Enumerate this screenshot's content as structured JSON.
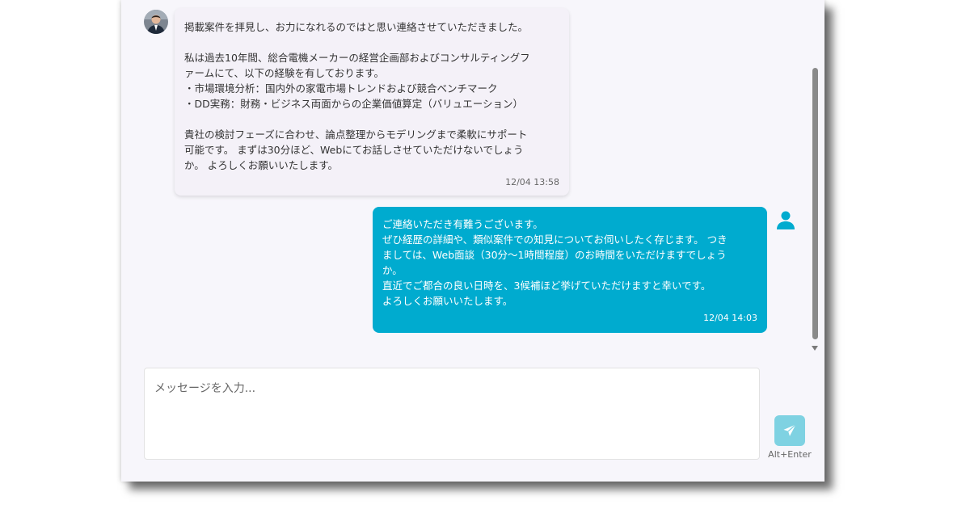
{
  "messages": [
    {
      "side": "received",
      "lines": [
        "掲載案件を拝見し、お力になれるのではと思い連絡させていただきました。",
        "",
        "私は過去10年間、総合電機メーカーの経営企画部およびコンサルティングフ",
        "ァームにて、以下の経験を有しております。",
        "・市場環境分析：国内外の家電市場トレンドおよび競合ベンチマーク",
        "・DD実務：財務・ビジネス両面からの企業価値算定（バリュエーション）",
        "",
        "貴社の検討フェーズに合わせ、論点整理からモデリングまで柔軟にサポート",
        "可能です。 まずは30分ほど、Webにてお話しさせていただけないでしょう",
        "か。 よろしくお願いいたします。"
      ],
      "time": "12/04 13:58"
    },
    {
      "side": "sent",
      "lines": [
        "ご連絡いただき有難うございます。",
        "ぜひ経歴の詳細や、類似案件での知見についてお伺いしたく存じます。 つき",
        "ましては、Web面談（30分〜1時間程度）のお時間をいただけますでしょう",
        "か。",
        "直近でご都合の良い日時を、3候補ほど挙げていただけますと幸いです。",
        "よろしくお願いいたします。"
      ],
      "time": "12/04 14:03"
    }
  ],
  "composer": {
    "placeholder": "メッセージを入力...",
    "send_hint": "Alt+Enter"
  },
  "icons": {
    "sender_avatar": "person-photo-avatar",
    "user": "user-icon",
    "send": "paper-plane-icon"
  },
  "colors": {
    "sent_bubble": "#00abcf",
    "received_bubble": "#f4f1f8",
    "send_button": "#7fd2e2"
  }
}
